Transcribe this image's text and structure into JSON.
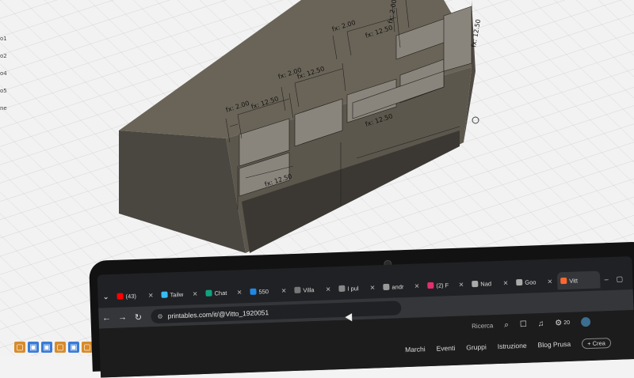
{
  "cad": {
    "sidebar_items": [
      "o1",
      "o2",
      "o4",
      "o5",
      "ne"
    ],
    "dimensions": [
      "fx: 2.00",
      "fx: 12.50",
      "fx: 2.00",
      "fx: 12.50",
      "fx: 2.00",
      "fx: 12.50",
      "fx: 2.00",
      "fx: 12.50",
      "fx: 12.50",
      "fx: 12.50"
    ]
  },
  "browser": {
    "tabs": [
      {
        "label": "(43)",
        "color": "#ff0000"
      },
      {
        "label": "Tailw",
        "color": "#38bdf8"
      },
      {
        "label": "Chat",
        "color": "#10a37f"
      },
      {
        "label": "550",
        "color": "#1e88e5"
      },
      {
        "label": "Villa",
        "color": "#777777"
      },
      {
        "label": "I pul",
        "color": "#888888"
      },
      {
        "label": "andr",
        "color": "#999999"
      },
      {
        "label": "(2) F",
        "color": "#e1306c"
      },
      {
        "label": "Nad",
        "color": "#aaaaaa"
      },
      {
        "label": "Goo",
        "color": "#aaaaaa"
      },
      {
        "label": "Vitt",
        "color": "#fa6831"
      }
    ],
    "url": "printables.com/it/@Vitto_1920051",
    "search_label": "Ricerca",
    "notification_count": "20",
    "menu": [
      "Eventi",
      "Gruppi",
      "Istruzione",
      "Blog Prusa"
    ],
    "partial_menu": "Marchi",
    "create_label": "+ Crea"
  }
}
